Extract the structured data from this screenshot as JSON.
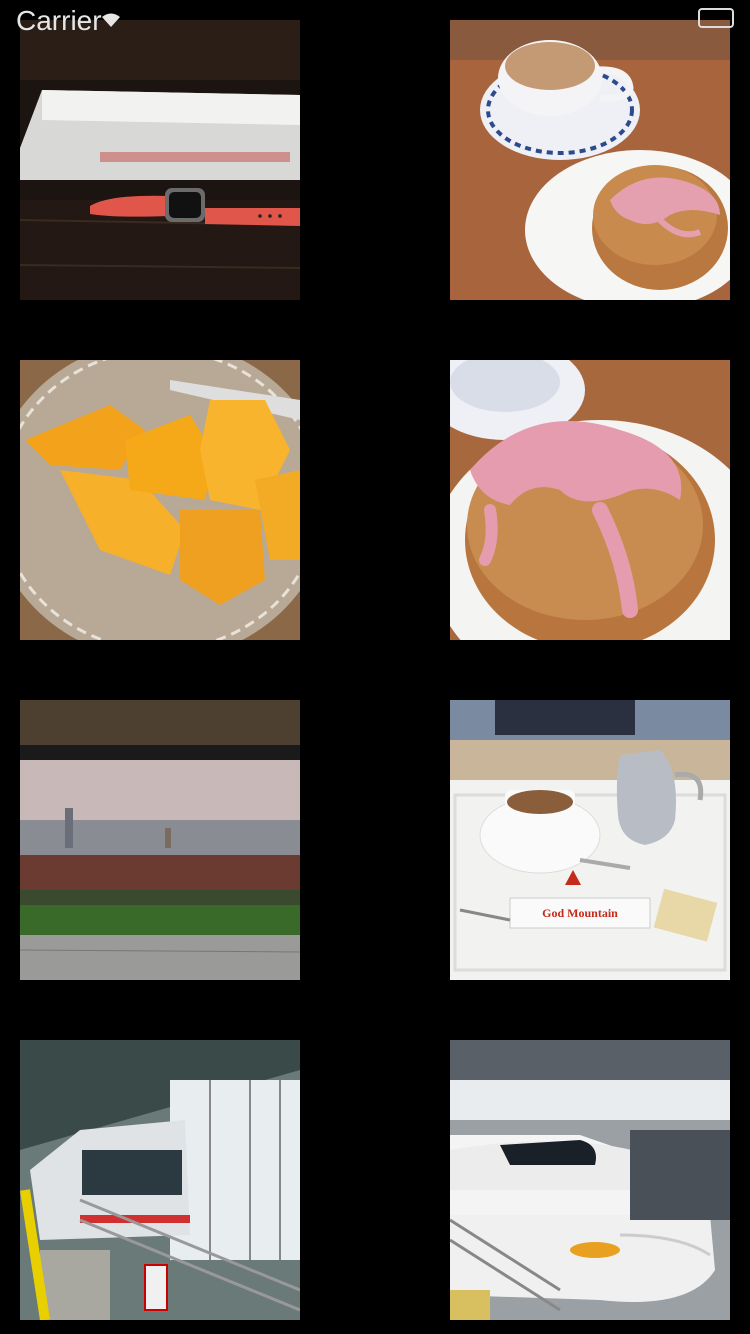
{
  "status_bar": {
    "carrier": "Carrier",
    "wifi_icon": "wifi-icon",
    "battery_icon": "battery-icon"
  },
  "photos": [
    {
      "name": "photo-watch-box",
      "subject": "smartwatch with red band beside white box"
    },
    {
      "name": "photo-coffee-cream-puff",
      "subject": "coffee cup and cream puff"
    },
    {
      "name": "photo-mango",
      "subject": "mango slices in glass bowl"
    },
    {
      "name": "photo-cream-puff-closeup",
      "subject": "cream puff with pink icing"
    },
    {
      "name": "photo-city-view",
      "subject": "city view from station platform"
    },
    {
      "name": "photo-coffee-tray",
      "subject": "coffee tray with teapot",
      "brand_text": "God Mountain"
    },
    {
      "name": "photo-monorail",
      "subject": "monorail at station"
    },
    {
      "name": "photo-bullet-train",
      "subject": "white bullet train at platform"
    }
  ],
  "colors": {
    "background": "#000000"
  }
}
